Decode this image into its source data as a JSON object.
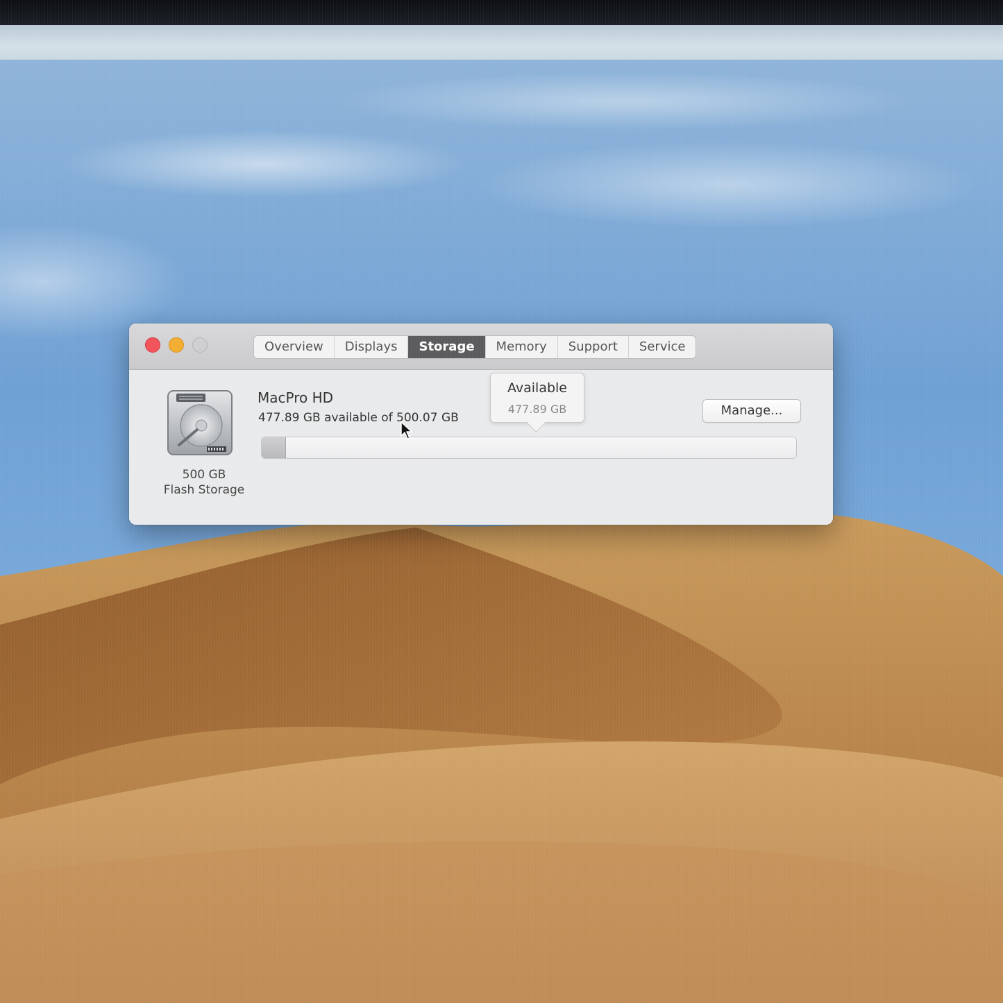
{
  "window": {
    "tabs": [
      {
        "label": "Overview",
        "active": false
      },
      {
        "label": "Displays",
        "active": false
      },
      {
        "label": "Storage",
        "active": true
      },
      {
        "label": "Memory",
        "active": false
      },
      {
        "label": "Support",
        "active": false
      },
      {
        "label": "Service",
        "active": false
      }
    ]
  },
  "disk": {
    "icon": "hard-drive-icon",
    "capacity": "500 GB",
    "type": "Flash Storage"
  },
  "volume": {
    "name": "MacPro HD",
    "detail": "477.89 GB available of 500.07 GB",
    "available_gb": 477.89,
    "total_gb": 500.07
  },
  "tooltip": {
    "title": "Available",
    "value": "477.89 GB"
  },
  "manage_button": {
    "label": "Manage..."
  },
  "colors": {
    "close": "#f0545a",
    "minimize": "#f2ad32",
    "zoom": "#cfcfd1",
    "active_tab": "#5b5b5e"
  }
}
